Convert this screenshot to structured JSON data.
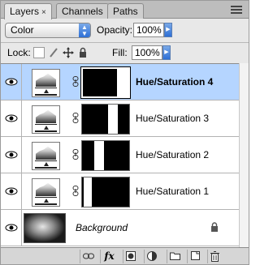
{
  "tabs": [
    {
      "label": "Layers"
    },
    {
      "label": "Channels"
    },
    {
      "label": "Paths"
    }
  ],
  "tab_close": "×",
  "blend_mode": {
    "value": "Color"
  },
  "opacity": {
    "label": "Opacity:",
    "value": "100%"
  },
  "lock": {
    "label": "Lock:"
  },
  "fill": {
    "label": "Fill:",
    "value": "100%"
  },
  "layers": [
    {
      "name": "Hue/Saturation 4",
      "selected": true,
      "mask_white": "right"
    },
    {
      "name": "Hue/Saturation 3",
      "selected": false,
      "mask_white": "right-mid"
    },
    {
      "name": "Hue/Saturation 2",
      "selected": false,
      "mask_white": "left-mid"
    },
    {
      "name": "Hue/Saturation 1",
      "selected": false,
      "mask_white": "left"
    }
  ],
  "background": {
    "name": "Background",
    "locked": true
  },
  "toolbar": {
    "fx_label": "fx"
  },
  "colors": {
    "selection": "#b5d5ff",
    "accent": "#2d6fd6",
    "panel": "#e8e8e8"
  },
  "icons": [
    "eye-icon",
    "link-icon",
    "lock-icon",
    "fx-icon",
    "mask-icon",
    "adjustment-icon",
    "folder-icon",
    "new-layer-icon",
    "trash-icon"
  ]
}
